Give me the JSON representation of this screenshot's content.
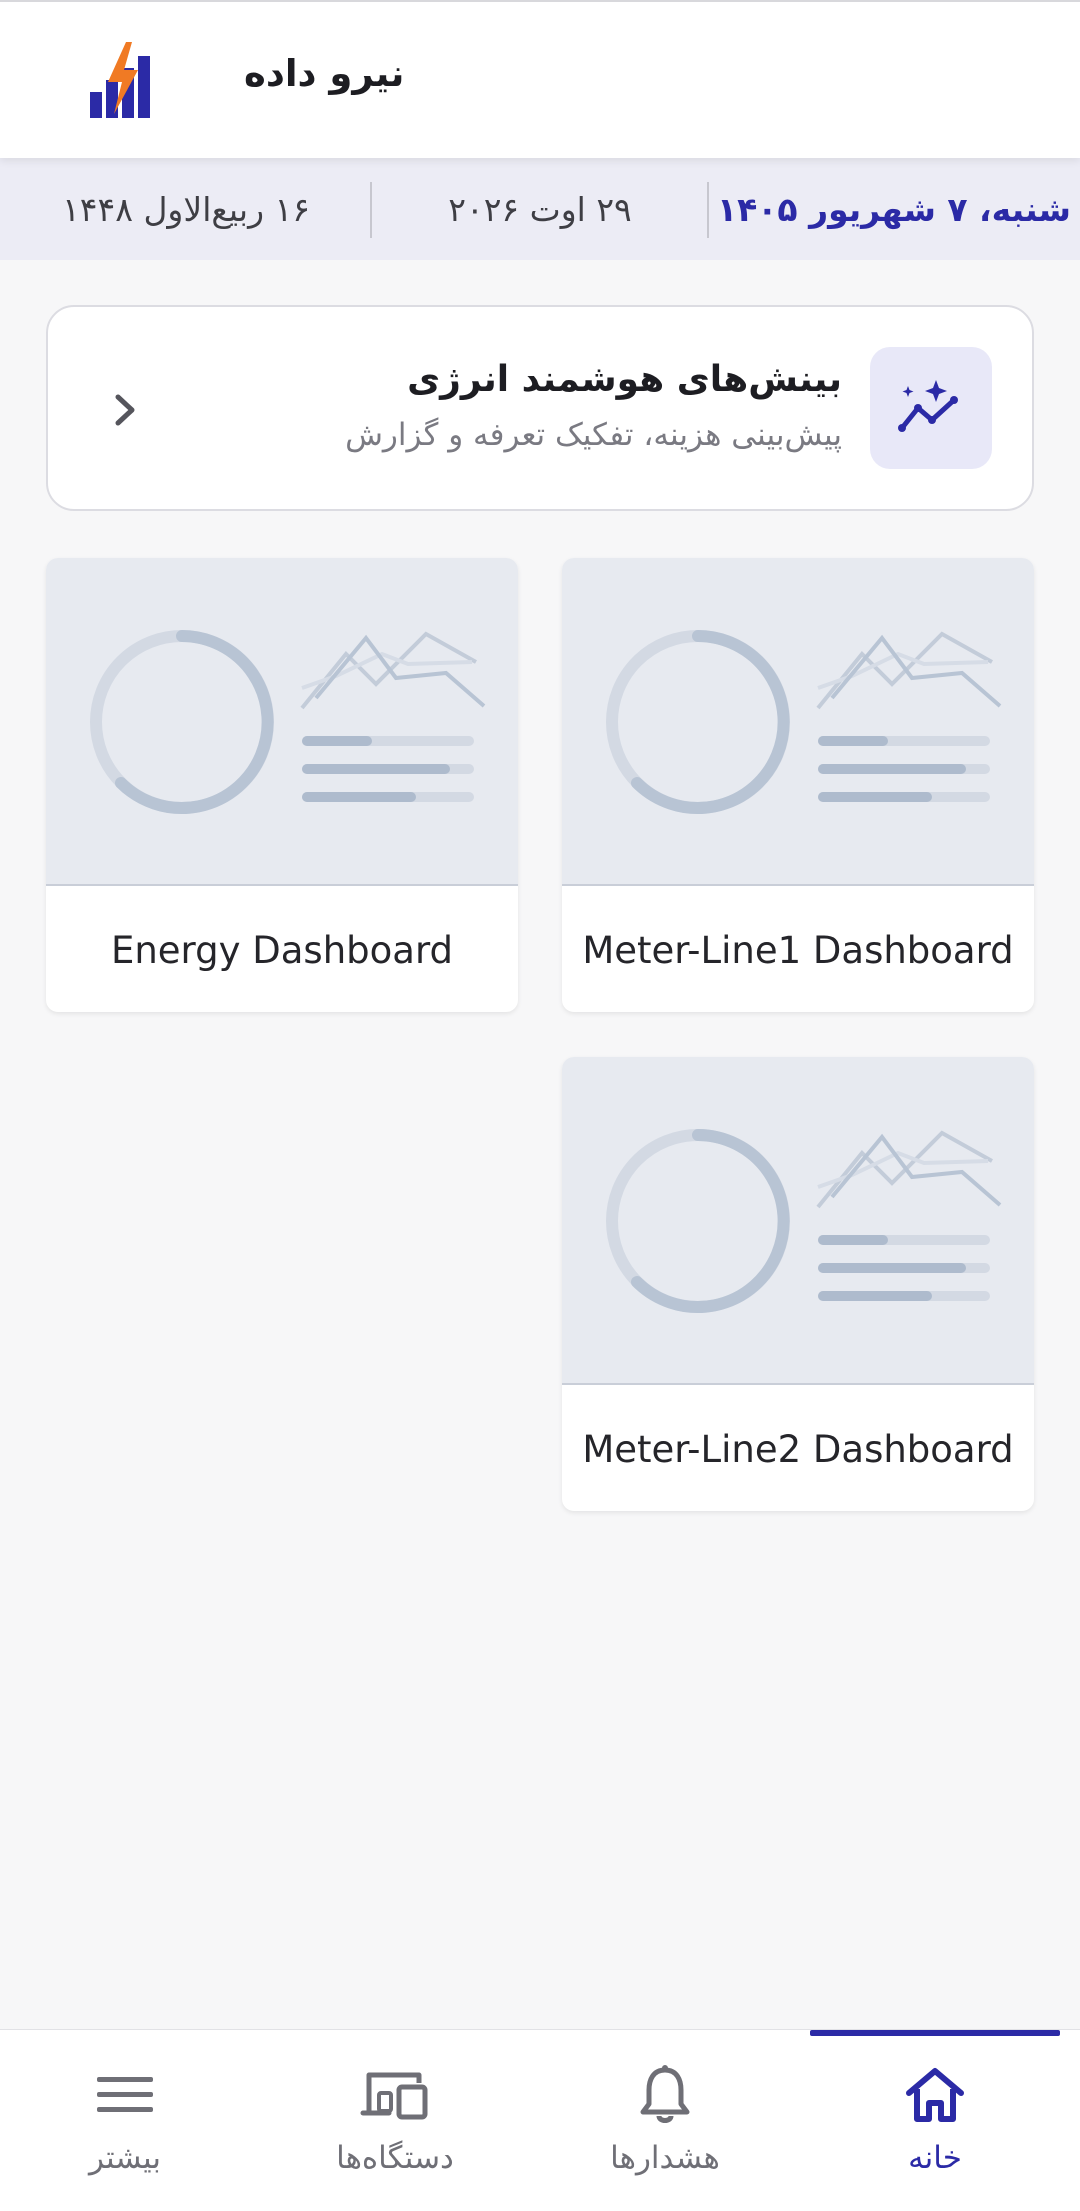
{
  "app": {
    "title": "نیرو داده",
    "logo_icon": "bolt-bar-chart-logo"
  },
  "date_bar": {
    "persian": "شنبه، ۷ شهریور ۱۴۰۵",
    "gregorian": "۲۹ اوت ۲۰۲۶",
    "hijri": "۱۶ ربیع‌الاول ۱۴۴۸"
  },
  "insights_card": {
    "title": "بینش‌های هوشمند انرژی",
    "subtitle": "پیش‌بینی هزینه، تفکیک تعرفه و گزارش",
    "icon": "sparkle-chart-icon",
    "chevron_icon": "chevron-right-icon"
  },
  "dashboards": [
    {
      "label": "Meter-Line1 Dashboard"
    },
    {
      "label": "Energy Dashboard"
    },
    {
      "label": "Meter-Line2 Dashboard"
    }
  ],
  "bottom_nav": {
    "items": [
      {
        "label": "خانه",
        "icon": "home-icon",
        "active": true
      },
      {
        "label": "هشدارها",
        "icon": "bell-icon",
        "active": false
      },
      {
        "label": "دستگاه‌ها",
        "icon": "devices-icon",
        "active": false
      },
      {
        "label": "بیشتر",
        "icon": "menu-icon",
        "active": false
      }
    ]
  },
  "colors": {
    "accent": "#2b2aa6",
    "logo_orange": "#f07a24",
    "date_bar_bg": "#ececf5",
    "thumbnail_bg": "#e7eaf0"
  }
}
